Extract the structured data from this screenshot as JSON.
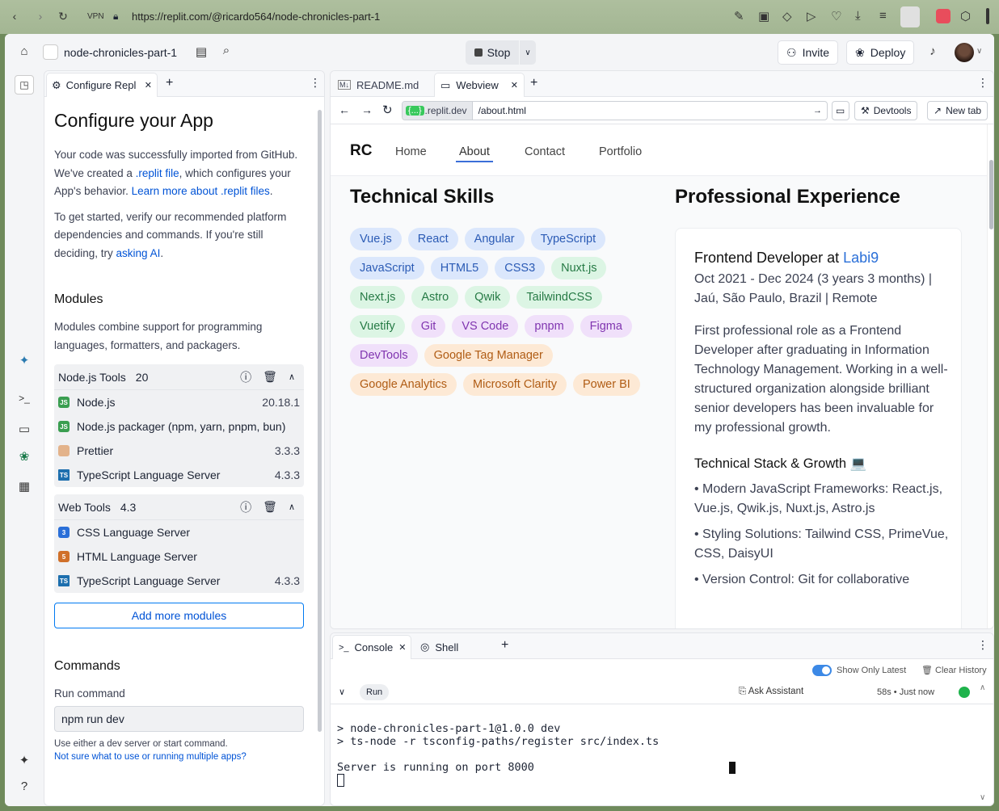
{
  "browser": {
    "vpn": "VPN",
    "url": "https://replit.com/@ricardo564/node-chronicles-part-1"
  },
  "topbar": {
    "repl_name": "node-chronicles-part-1",
    "stop_label": "Stop",
    "invite_label": "Invite",
    "deploy_label": "Deploy"
  },
  "left_tab": {
    "label": "Configure Repl"
  },
  "configure": {
    "title": "Configure your App",
    "intro_1": "Your code was successfully imported from GitHub. We've created a ",
    "intro_link1": ".replit file",
    "intro_2": ", which configures your App's behavior. ",
    "intro_link2": "Learn more about .replit files",
    "intro_3": ".",
    "verify_1": "To get started, verify our recommended platform dependencies and commands. If you're still deciding, try ",
    "verify_link": "asking AI",
    "verify_2": ".",
    "modules_title": "Modules",
    "modules_desc": "Modules combine support for programming languages, formatters, and packagers.",
    "groups": [
      {
        "name": "Node.js Tools",
        "version": "20",
        "items": [
          {
            "name": "Node.js",
            "version": "20.18.1"
          },
          {
            "name": "Node.js packager (npm, yarn, pnpm, bun)",
            "version": ""
          },
          {
            "name": "Prettier",
            "version": "3.3.3"
          },
          {
            "name": "TypeScript Language Server",
            "version": "4.3.3"
          }
        ]
      },
      {
        "name": "Web Tools",
        "version": "4.3",
        "items": [
          {
            "name": "CSS Language Server",
            "version": ""
          },
          {
            "name": "HTML Language Server",
            "version": ""
          },
          {
            "name": "TypeScript Language Server",
            "version": "4.3.3"
          }
        ]
      }
    ],
    "add_modules": "Add more modules",
    "commands_title": "Commands",
    "run_label": "Run command",
    "run_value": "npm run dev",
    "hint": "Use either a dev server or start command.",
    "hint_link": "Not sure what to use or running multiple apps?"
  },
  "right_tabs": {
    "readme": "README.md",
    "webview": "Webview"
  },
  "webview_bar": {
    "host": ".replit.dev",
    "badge": "{...}",
    "path": "/about.html",
    "devtools": "Devtools",
    "newtab": "New tab"
  },
  "site": {
    "logo": "RC",
    "nav": [
      "Home",
      "About",
      "Contact",
      "Portfolio"
    ],
    "skills_title": "Technical Skills",
    "skills": [
      {
        "name": "Vue.js",
        "color": "blue"
      },
      {
        "name": "React",
        "color": "blue"
      },
      {
        "name": "Angular",
        "color": "blue"
      },
      {
        "name": "TypeScript",
        "color": "blue"
      },
      {
        "name": "JavaScript",
        "color": "blue"
      },
      {
        "name": "HTML5",
        "color": "blue"
      },
      {
        "name": "CSS3",
        "color": "blue"
      },
      {
        "name": "Nuxt.js",
        "color": "green"
      },
      {
        "name": "Next.js",
        "color": "green"
      },
      {
        "name": "Astro",
        "color": "green"
      },
      {
        "name": "Qwik",
        "color": "green"
      },
      {
        "name": "TailwindCSS",
        "color": "green"
      },
      {
        "name": "Vuetify",
        "color": "green"
      },
      {
        "name": "Git",
        "color": "purple"
      },
      {
        "name": "VS Code",
        "color": "purple"
      },
      {
        "name": "pnpm",
        "color": "purple"
      },
      {
        "name": "Figma",
        "color": "purple"
      },
      {
        "name": "DevTools",
        "color": "purple"
      },
      {
        "name": "Google Tag Manager",
        "color": "orange"
      },
      {
        "name": "Google Analytics",
        "color": "orange"
      },
      {
        "name": "Microsoft Clarity",
        "color": "orange"
      },
      {
        "name": "Power BI",
        "color": "orange"
      }
    ],
    "exp_title": "Professional Experience",
    "job_title": "Frontend Developer at ",
    "job_company": "Labi9",
    "job_dates": "Oct 2021 - Dec 2024 (3 years 3 months) | Jaú, São Paulo, Brazil | Remote",
    "job_desc": "First professional role as a Frontend Developer after graduating in Information Technology Management. Working in a well-structured organization alongside brilliant senior developers has been invaluable for my professional growth.",
    "stack_title": "Technical Stack & Growth 💻",
    "bullet1": "• Modern JavaScript Frameworks: React.js, Vue.js, Qwik.js, Nuxt.js, Astro.js",
    "bullet2": "• Styling Solutions: Tailwind CSS, PrimeVue, CSS, DaisyUI",
    "bullet3": "• Version Control: Git for collaborative"
  },
  "console": {
    "tab_console": "Console",
    "tab_shell": "Shell",
    "show_latest": "Show Only Latest",
    "clear_history": "Clear History",
    "run_badge": "Run",
    "ask_assistant": "Ask Assistant",
    "timing": "58s • Just now",
    "line1": "> node-chronicles-part-1@1.0.0 dev",
    "line2": "> ts-node -r tsconfig-paths/register src/index.ts",
    "line3": "Server is running on port 8000"
  }
}
